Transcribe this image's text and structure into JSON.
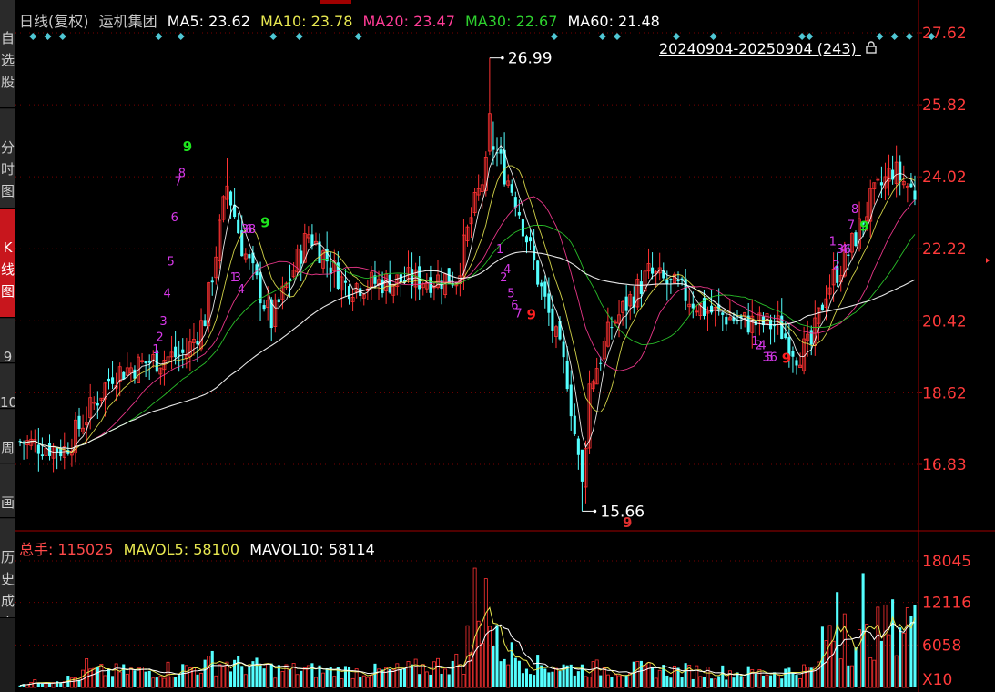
{
  "sidebar": {
    "items": [
      {
        "label": "自\n选\n股",
        "active": false
      },
      {
        "label": "分\n时\n图",
        "active": false
      },
      {
        "label": "K\n线\n图",
        "active": true
      },
      {
        "label": "9",
        "active": false
      },
      {
        "label": "10",
        "active": false
      },
      {
        "label": "周\n期",
        "active": false
      },
      {
        "label": "画\n线",
        "active": false
      },
      {
        "label": "历\n史\n成\n交",
        "active": false
      }
    ]
  },
  "legend": {
    "period": "日线(复权)",
    "name": "运机集团",
    "ma5": "MA5: 23.62",
    "ma10": "MA10: 23.78",
    "ma20": "MA20: 23.47",
    "ma30": "MA30: 22.67",
    "ma60": "MA60: 21.48"
  },
  "range_label": "20240904-20250904 (243)",
  "volume_legend": {
    "total": "总手: 115025",
    "mavol5": "MAVOL5: 58100",
    "mavol10": "MAVOL10: 58114"
  },
  "colors": {
    "up": "#ff3232",
    "down": "#54ffff",
    "ma5": "#ffffff",
    "ma10": "#e8e850",
    "ma20": "#ff3c96",
    "ma30": "#2ed12e",
    "ma60": "#ffffff",
    "axis_text": "#ff3a3a",
    "grid": "#7a0000",
    "marker": "#4fc7d4",
    "td_magenta": "#d638e8",
    "td_green": "#1ee61e",
    "td_red": "#ff2020"
  },
  "chart_data": {
    "type": "candlestick",
    "price_axis": {
      "ticks": [
        "27.62",
        "25.82",
        "24.02",
        "22.22",
        "20.42",
        "18.62",
        "16.83"
      ],
      "ylim": [
        16.83,
        27.62
      ]
    },
    "volume_axis": {
      "ticks": [
        "18045",
        "12116",
        "6058"
      ],
      "unit": "X10"
    },
    "annotations": [
      {
        "label": "26.99",
        "value": 26.99,
        "type": "high"
      },
      {
        "label": "15.66",
        "value": 15.66,
        "type": "low"
      }
    ],
    "bottom_mark": "9",
    "anchors": [
      {
        "i": 0,
        "p": 17.4
      },
      {
        "i": 12,
        "p": 17.2
      },
      {
        "i": 17,
        "p": 17.9
      },
      {
        "i": 25,
        "p": 19.1
      },
      {
        "i": 35,
        "p": 19.4
      },
      {
        "i": 45,
        "p": 19.6
      },
      {
        "i": 50,
        "p": 20.5
      },
      {
        "i": 56,
        "p": 23.8
      },
      {
        "i": 60,
        "p": 22.3
      },
      {
        "i": 68,
        "p": 20.4
      },
      {
        "i": 78,
        "p": 22.6
      },
      {
        "i": 88,
        "p": 21.3
      },
      {
        "i": 100,
        "p": 21.4
      },
      {
        "i": 118,
        "p": 21.5
      },
      {
        "i": 122,
        "p": 23.0
      },
      {
        "i": 128,
        "p": 24.8
      },
      {
        "i": 134,
        "p": 23.5
      },
      {
        "i": 140,
        "p": 21.5
      },
      {
        "i": 148,
        "p": 19.0
      },
      {
        "i": 152,
        "p": 16.2
      },
      {
        "i": 154,
        "p": 18.8
      },
      {
        "i": 160,
        "p": 20.3
      },
      {
        "i": 170,
        "p": 21.6
      },
      {
        "i": 178,
        "p": 21.2
      },
      {
        "i": 185,
        "p": 20.7
      },
      {
        "i": 195,
        "p": 20.4
      },
      {
        "i": 205,
        "p": 20.3
      },
      {
        "i": 210,
        "p": 19.6
      },
      {
        "i": 214,
        "p": 19.8
      },
      {
        "i": 218,
        "p": 21.2
      },
      {
        "i": 224,
        "p": 22.1
      },
      {
        "i": 230,
        "p": 23.4
      },
      {
        "i": 236,
        "p": 24.2
      },
      {
        "i": 242,
        "p": 23.6
      }
    ],
    "volume_anchors": [
      {
        "i": 0,
        "v": 600
      },
      {
        "i": 15,
        "v": 1500
      },
      {
        "i": 20,
        "v": 2500
      },
      {
        "i": 40,
        "v": 2600
      },
      {
        "i": 55,
        "v": 3800
      },
      {
        "i": 70,
        "v": 2800
      },
      {
        "i": 100,
        "v": 2500
      },
      {
        "i": 120,
        "v": 4000
      },
      {
        "i": 125,
        "v": 11000
      },
      {
        "i": 130,
        "v": 6000
      },
      {
        "i": 140,
        "v": 3500
      },
      {
        "i": 152,
        "v": 3000
      },
      {
        "i": 170,
        "v": 2800
      },
      {
        "i": 200,
        "v": 2300
      },
      {
        "i": 215,
        "v": 2800
      },
      {
        "i": 218,
        "v": 8500
      },
      {
        "i": 225,
        "v": 6500
      },
      {
        "i": 242,
        "v": 11500
      }
    ],
    "volume_spikes": [
      {
        "i": 18,
        "v": 4100
      },
      {
        "i": 40,
        "v": 3600
      },
      {
        "i": 52,
        "v": 5200
      },
      {
        "i": 121,
        "v": 8800
      },
      {
        "i": 123,
        "v": 17000
      },
      {
        "i": 126,
        "v": 15500
      },
      {
        "i": 221,
        "v": 13600
      },
      {
        "i": 223,
        "v": 10500
      },
      {
        "i": 228,
        "v": 16300
      },
      {
        "i": 242,
        "v": 11800
      }
    ]
  }
}
